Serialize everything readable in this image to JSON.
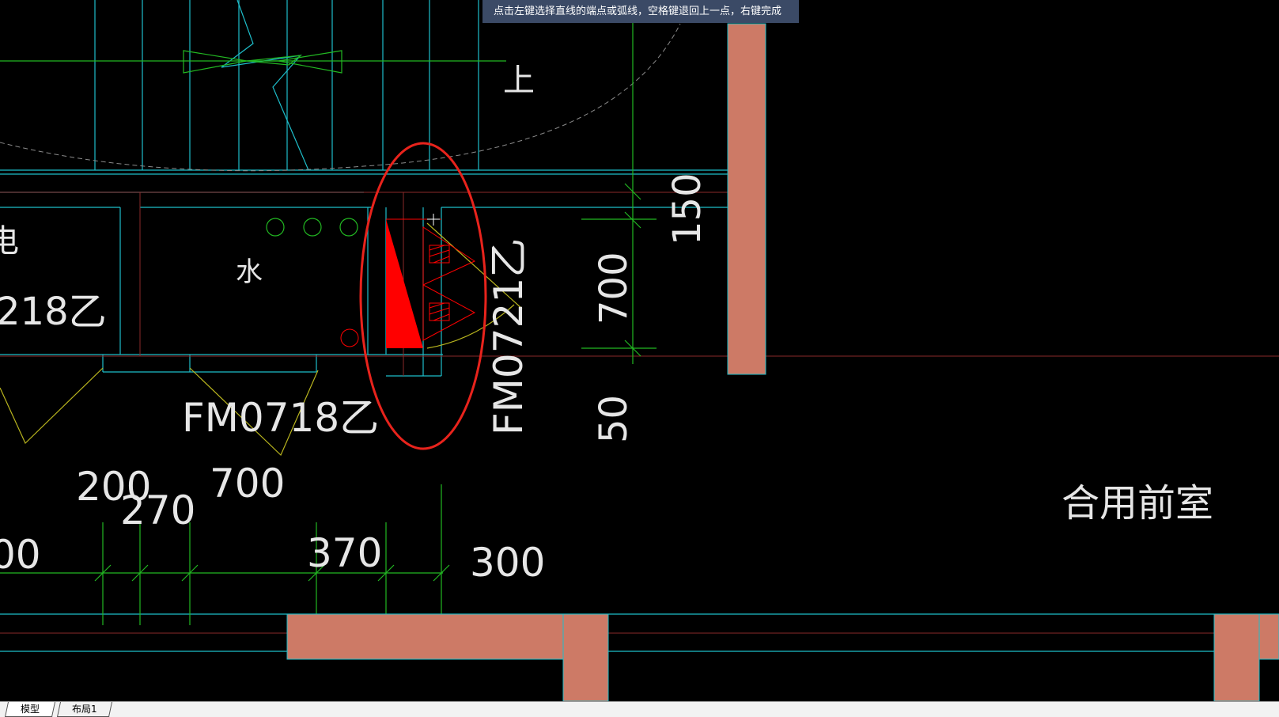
{
  "command_prompt": "点击左键选择直线的端点或弧线，空格键退回上一点，右键完成",
  "drawing": {
    "room_labels": {
      "water": "水",
      "up": "上",
      "shared_anteroom": "合用前室",
      "partial_char": "电"
    },
    "door_labels": {
      "fm0718_left": "218乙",
      "fm0718": "FM0718乙",
      "fm0721": "FM0721乙"
    },
    "dimensions": {
      "d150": "150",
      "d700_vertical": "700",
      "d50": "50",
      "d200": "200",
      "d270": "270",
      "d700": "700",
      "d370": "370",
      "d300": "300",
      "d_partial": "00"
    },
    "colors": {
      "background": "#000000",
      "wall": "#cd7a66",
      "cyan": "#1ebeca",
      "green": "#22b822",
      "yellow": "#b8b41e",
      "red": "#ff0000",
      "dark_red": "#8a2a2a",
      "text": "#e6e6e6",
      "highlight_ellipse": "#e8231c"
    }
  },
  "tabs": {
    "model": "模型",
    "layout1": "布局1"
  }
}
